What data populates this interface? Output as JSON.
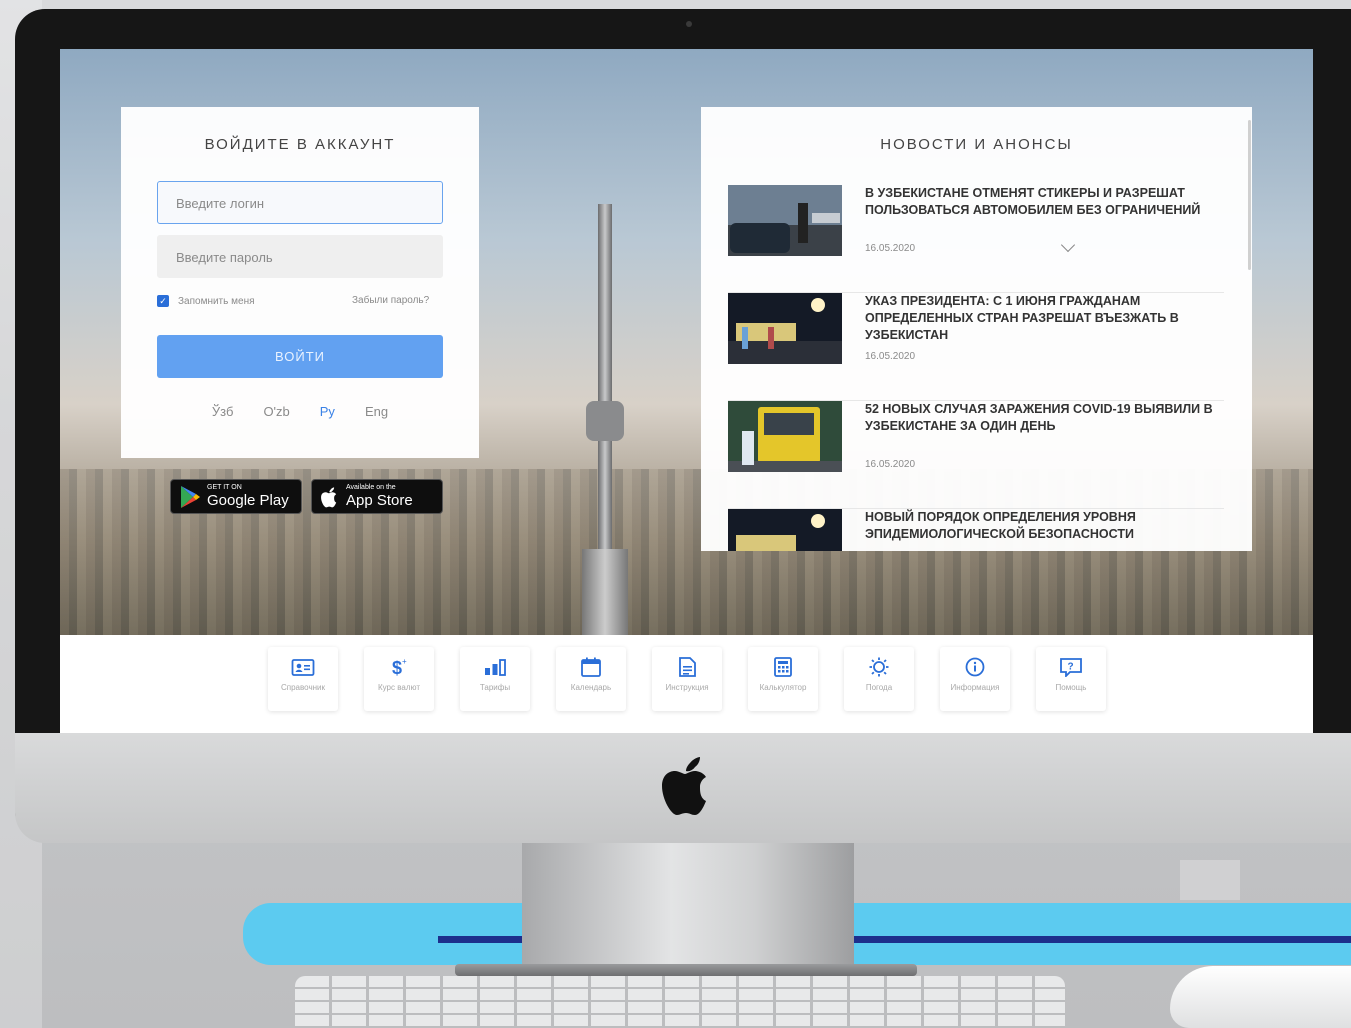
{
  "login": {
    "title": "ВОЙДИТЕ В АККАУНТ",
    "login_placeholder": "Введите логин",
    "password_placeholder": "Введите пароль",
    "remember_label": "Запомнить меня",
    "remember_checked": true,
    "forgot_label": "Забыли пароль?",
    "submit_label": "ВОЙТИ",
    "languages": [
      "Ўзб",
      "O'zb",
      "Ру",
      "Eng"
    ],
    "active_language": "Ру"
  },
  "stores": {
    "google_small": "GET IT ON",
    "google_big": "Google Play",
    "apple_small": "Available on the",
    "apple_big": "App Store"
  },
  "news": {
    "title": "НОВОСТИ И АНОНСЫ",
    "items": [
      {
        "headline": "В УЗБЕКИСТАНЕ ОТМЕНЯТ СТИКЕРЫ И РАЗРЕШАТ ПОЛЬЗОВАТЬСЯ АВТОМОБИЛЕМ БЕЗ ОГРАНИЧЕНИЙ",
        "date": "16.05.2020"
      },
      {
        "headline": "УКАЗ ПРЕЗИДЕНТА: С 1 ИЮНЯ ГРАЖДАНАМ ОПРЕДЕЛЕННЫХ СТРАН РАЗРЕШАТ ВЪЕЗЖАТЬ В УЗБЕКИСТАН",
        "date": "16.05.2020"
      },
      {
        "headline": "52 НОВЫХ СЛУЧАЯ ЗАРАЖЕНИЯ COVID-19 ВЫЯВИЛИ В УЗБЕКИСТАНЕ ЗА ОДИН ДЕНЬ",
        "date": "16.05.2020"
      },
      {
        "headline": "НОВЫЙ ПОРЯДОК ОПРЕДЕЛЕНИЯ УРОВНЯ ЭПИДЕМИОЛОГИЧЕСКОЙ БЕЗОПАСНОСТИ",
        "date": ""
      }
    ]
  },
  "toolbar": {
    "items": [
      {
        "label": "Справочник",
        "icon": "contact-card-icon"
      },
      {
        "label": "Курс валют",
        "icon": "currency-icon"
      },
      {
        "label": "Тарифы",
        "icon": "bar-chart-icon"
      },
      {
        "label": "Календарь",
        "icon": "calendar-icon"
      },
      {
        "label": "Инструкция",
        "icon": "document-icon"
      },
      {
        "label": "Калькулятор",
        "icon": "calculator-icon"
      },
      {
        "label": "Погода",
        "icon": "sun-icon"
      },
      {
        "label": "Информация",
        "icon": "info-icon"
      },
      {
        "label": "Помощь",
        "icon": "help-icon"
      }
    ],
    "icon_color": "#2a6ed8"
  },
  "colors": {
    "accent": "#62a1f1",
    "link_active": "#3b82e6",
    "band_cyan": "#5ccbf0",
    "band_navy": "#1d2f8c"
  }
}
